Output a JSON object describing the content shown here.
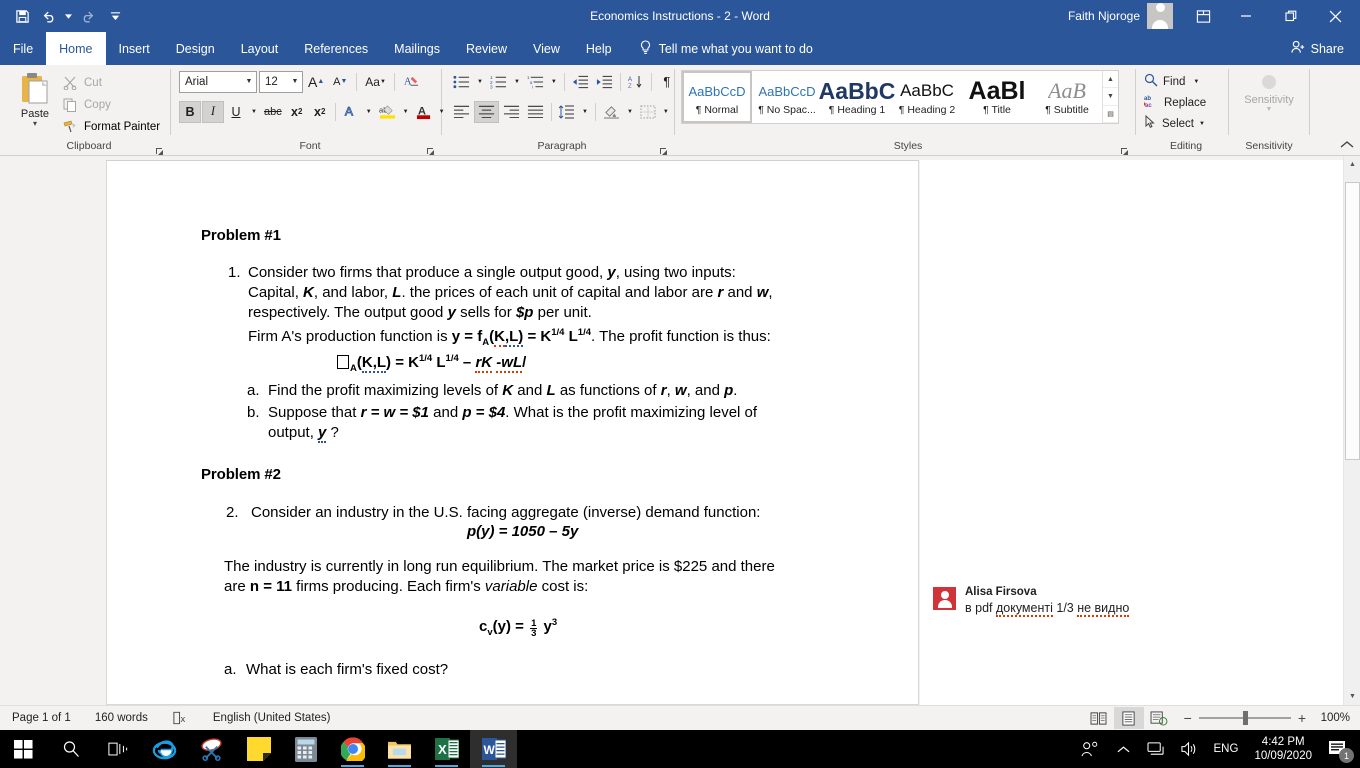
{
  "titlebar": {
    "document_title": "Economics Instructions - 2  -  Word",
    "account_name": "Faith Njoroge",
    "qat": [
      {
        "name": "save",
        "icon": "save-icon"
      },
      {
        "name": "undo",
        "icon": "undo-icon"
      },
      {
        "name": "redo",
        "icon": "redo-icon"
      },
      {
        "name": "customize-qat",
        "icon": "chevron-down-icon"
      }
    ],
    "window_controls": {
      "ribbon_display": "ribbon-display-options-icon",
      "minimize": "minimize-icon",
      "restore": "restore-icon",
      "close": "close-icon"
    }
  },
  "tabs": [
    {
      "label": "File",
      "active": false
    },
    {
      "label": "Home",
      "active": true
    },
    {
      "label": "Insert",
      "active": false
    },
    {
      "label": "Design",
      "active": false
    },
    {
      "label": "Layout",
      "active": false
    },
    {
      "label": "References",
      "active": false
    },
    {
      "label": "Mailings",
      "active": false
    },
    {
      "label": "Review",
      "active": false
    },
    {
      "label": "View",
      "active": false
    },
    {
      "label": "Help",
      "active": false
    }
  ],
  "tellme": "Tell me what you want to do",
  "share": "Share",
  "ribbon": {
    "clipboard": {
      "group_label": "Clipboard",
      "paste_label": "Paste",
      "commands": [
        {
          "label": "Cut",
          "icon": "scissors-icon",
          "disabled": true
        },
        {
          "label": "Copy",
          "icon": "copy-icon",
          "disabled": true
        },
        {
          "label": "Format Painter",
          "icon": "format-painter-icon",
          "disabled": false
        }
      ]
    },
    "font": {
      "group_label": "Font",
      "font_name": "Arial",
      "font_size": "12",
      "buttons_row1": [
        {
          "label": "A",
          "name": "grow-font-button"
        },
        {
          "label": "A",
          "name": "shrink-font-button"
        },
        {
          "label": "Aa",
          "name": "change-case-button"
        },
        {
          "label": "",
          "name": "clear-formatting-button"
        }
      ],
      "buttons_row2": [
        {
          "label": "B",
          "name": "bold-button"
        },
        {
          "label": "I",
          "name": "italic-button"
        },
        {
          "label": "U",
          "name": "underline-button"
        },
        {
          "label": "abc",
          "name": "strikethrough-button"
        },
        {
          "label": "x",
          "name": "subscript-button"
        },
        {
          "label": "x",
          "name": "superscript-button"
        },
        {
          "label": "A",
          "name": "text-effects-button"
        },
        {
          "label": "ab",
          "name": "text-highlight-color-button"
        },
        {
          "label": "A",
          "name": "font-color-button"
        }
      ]
    },
    "paragraph": {
      "group_label": "Paragraph",
      "row1": [
        "bullets-icon",
        "numbering-icon",
        "multilevel-list-icon",
        "decrease-indent-icon",
        "increase-indent-icon",
        "sort-icon",
        "show-formatting-marks-icon"
      ],
      "row2": [
        "align-left-icon",
        "align-center-icon",
        "align-right-icon",
        "justify-icon",
        "line-spacing-icon",
        "shading-icon",
        "borders-icon"
      ]
    },
    "styles": {
      "group_label": "Styles",
      "items": [
        {
          "preview": "AaBbCcD",
          "name": "¶ Normal",
          "selected": true
        },
        {
          "preview": "AaBbCcD",
          "name": "¶ No Spac...",
          "selected": false
        },
        {
          "preview": "AaBbC",
          "name": "¶ Heading 1",
          "selected": false
        },
        {
          "preview": "AaBbC",
          "name": "¶ Heading 2",
          "selected": false
        },
        {
          "preview": "AaBl",
          "name": "¶ Title",
          "selected": false
        },
        {
          "preview": "AaB",
          "name": "¶ Subtitle",
          "selected": false
        }
      ]
    },
    "editing": {
      "group_label": "Editing",
      "commands": [
        {
          "label": "Find",
          "icon": "search-icon",
          "caret": true
        },
        {
          "label": "Replace",
          "icon": "replace-icon",
          "caret": false
        },
        {
          "label": "Select",
          "icon": "select-icon",
          "caret": true
        }
      ]
    },
    "sensitivity": {
      "group_label": "Sensitivity",
      "button_label": "Sensitivity"
    }
  },
  "document": {
    "problem1_heading": "Problem #1",
    "item1_number": "1.",
    "item1_lines": [
      "Consider two firms that produce a single output good, y, using two inputs:",
      "Capital, K, and labor, L. the prices of each unit of capital and labor are r and w,",
      "respectively. The output good y sells for $p per unit.",
      "Firm A's production function is y = fA(K,L) = K1/4 L1/4. The profit function is thus:"
    ],
    "formula1": "□A(K,L) = K1/4 L1/4 – rK -wL/",
    "item1_sub": [
      {
        "marker": "a.",
        "text": "Find the profit maximizing levels of K and L as functions of r, w, and p."
      },
      {
        "marker": "b.",
        "text": "Suppose that r = w = $1 and p = $4. What is the profit maximizing level of output, y ?"
      }
    ],
    "problem2_heading": "Problem #2",
    "item2_number": "2.",
    "item2_text": "Consider an industry in the U.S. facing aggregate (inverse) demand function:",
    "formula2": "p(y) = 1050 – 5y",
    "item2_para": "The industry is currently in long run equilibrium. The market price is $225 and there are n = 11 firms producing. Each firm's variable cost is:",
    "formula3": "cv(y) = 1/3 y3",
    "item2_sub": [
      {
        "marker": "a.",
        "text": "What is each firm's fixed cost?"
      }
    ]
  },
  "comment": {
    "author": "Alisa Firsova",
    "text_plain": "в pdf документі 1/3 не видно",
    "segments": [
      {
        "t": "в pdf ",
        "wavy": false
      },
      {
        "t": "документі",
        "wavy": true
      },
      {
        "t": " 1/3 ",
        "wavy": false
      },
      {
        "t": "не видно",
        "wavy": true
      }
    ]
  },
  "statusbar": {
    "page": "Page 1 of 1",
    "words": "160 words",
    "proofing_icon": "proofing-errors-icon",
    "language": "English (United States)",
    "views": [
      {
        "name": "read-mode-view-button",
        "active": false
      },
      {
        "name": "print-layout-view-button",
        "active": true
      },
      {
        "name": "web-layout-view-button",
        "active": false
      }
    ],
    "zoom_out": "−",
    "zoom_in": "+",
    "zoom_level": "100%"
  },
  "taskbar": {
    "items": [
      {
        "name": "start-button",
        "icon": "windows-logo-icon",
        "running": false,
        "active": false
      },
      {
        "name": "search-button",
        "icon": "search-icon",
        "running": false,
        "active": false
      },
      {
        "name": "task-view-button",
        "icon": "task-view-icon",
        "running": false,
        "active": false
      },
      {
        "name": "internet-explorer-button",
        "icon": "internet-explorer-icon",
        "running": false,
        "active": false
      },
      {
        "name": "snipping-tool-button",
        "icon": "snipping-tool-icon",
        "running": false,
        "active": false
      },
      {
        "name": "sticky-notes-button",
        "icon": "sticky-notes-icon",
        "running": false,
        "active": false
      },
      {
        "name": "calculator-button",
        "icon": "calculator-icon",
        "running": false,
        "active": false
      },
      {
        "name": "google-chrome-button",
        "icon": "chrome-icon",
        "running": true,
        "active": false
      },
      {
        "name": "file-explorer-button",
        "icon": "folder-icon",
        "running": true,
        "active": false
      },
      {
        "name": "excel-button",
        "icon": "excel-icon",
        "running": true,
        "active": false
      },
      {
        "name": "word-button",
        "icon": "word-icon",
        "running": true,
        "active": true
      }
    ],
    "tray": {
      "people_icon": "people-icon",
      "show_hidden_icon": "chevron-up-icon",
      "network_icon": "network-icon",
      "volume_icon": "volume-icon",
      "language": "ENG",
      "time": "4:42 PM",
      "date": "10/09/2020",
      "notifications_count": "1"
    }
  },
  "colors": {
    "word_blue": "#2b579a",
    "ribbon_bg": "#f3f2f1",
    "accent_red": "#d13438",
    "spell_red": "#d83b01",
    "grammar_blue": "#2b579a"
  }
}
